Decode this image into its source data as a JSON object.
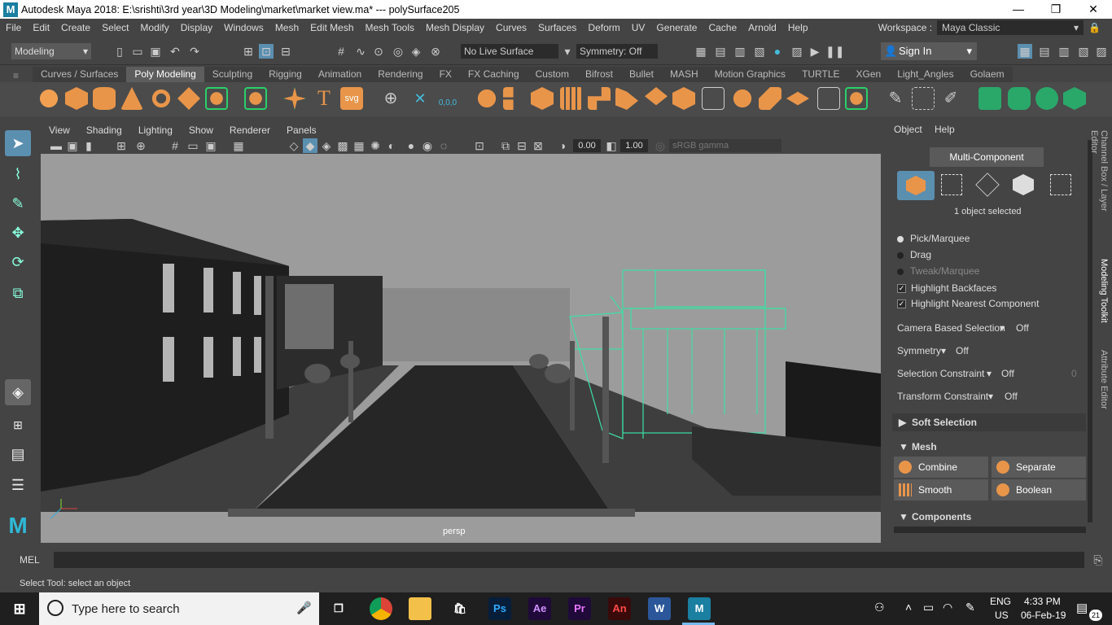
{
  "title_bar": {
    "logo": "M",
    "title": "Autodesk Maya 2018: E:\\srishti\\3rd year\\3D Modeling\\market\\market view.ma*   ---   polySurface205",
    "minimize": "—",
    "maximize": "❐",
    "close": "✕"
  },
  "menu": [
    "File",
    "Edit",
    "Create",
    "Select",
    "Modify",
    "Display",
    "Windows",
    "Mesh",
    "Edit Mesh",
    "Mesh Tools",
    "Mesh Display",
    "Curves",
    "Surfaces",
    "Deform",
    "UV",
    "Generate",
    "Cache",
    "Arnold",
    "Help"
  ],
  "workspace": {
    "label": "Workspace :",
    "value": "Maya Classic"
  },
  "status_line": {
    "mode": "Modeling",
    "live_surface": "No Live Surface",
    "symmetry": "Symmetry: Off",
    "sign_in": "Sign In"
  },
  "shelf_tabs": [
    "Curves / Surfaces",
    "Poly Modeling",
    "Sculpting",
    "Rigging",
    "Animation",
    "Rendering",
    "FX",
    "FX Caching",
    "Custom",
    "Bifrost",
    "Bullet",
    "MASH",
    "Motion Graphics",
    "TURTLE",
    "XGen",
    "Light_Angles",
    "Golaem"
  ],
  "shelf_active": "Poly Modeling",
  "shelf_text_icons": {
    "type": "T",
    "svg": "svg",
    "coords": "0,0,0"
  },
  "viewport": {
    "menu": [
      "View",
      "Shading",
      "Lighting",
      "Show",
      "Renderer",
      "Panels"
    ],
    "exposure": "0.00",
    "gamma": "1.00",
    "color_space": "sRGB gamma",
    "camera": "persp"
  },
  "right_panel": {
    "menu": [
      "Object",
      "Help"
    ],
    "mode_button": "Multi-Component",
    "selected_info": "1 object selected",
    "pick_options": [
      {
        "label": "Pick/Marquee",
        "selected": true
      },
      {
        "label": "Drag",
        "selected": false
      },
      {
        "label": "Tweak/Marquee",
        "selected": false
      }
    ],
    "checks": [
      {
        "label": "Highlight Backfaces",
        "checked": true
      },
      {
        "label": "Highlight Nearest Component",
        "checked": true
      }
    ],
    "settings": [
      {
        "label": "Camera Based Selection",
        "value": "Off"
      },
      {
        "label": "Symmetry",
        "value": "Off"
      },
      {
        "label": "Selection Constraint",
        "value": "Off",
        "extra": "0"
      },
      {
        "label": "Transform Constraint",
        "value": "Off"
      }
    ],
    "sections": {
      "soft_selection": "Soft Selection",
      "mesh": "Mesh",
      "components": "Components"
    },
    "mesh_buttons": [
      "Combine",
      "Separate",
      "Smooth",
      "Boolean"
    ],
    "side_tabs": [
      "Channel Box / Layer Editor",
      "Modeling Toolkit",
      "Attribute Editor"
    ]
  },
  "command_line": {
    "label": "MEL"
  },
  "help_line": "Select Tool: select an object",
  "taskbar": {
    "search_placeholder": "Type here to search",
    "apps": [
      "Ps",
      "Ae",
      "Pr",
      "An",
      "W",
      "M"
    ],
    "lang": "ENG",
    "region": "US",
    "time": "4:33 PM",
    "date": "06-Feb-19",
    "notifications": "21"
  }
}
